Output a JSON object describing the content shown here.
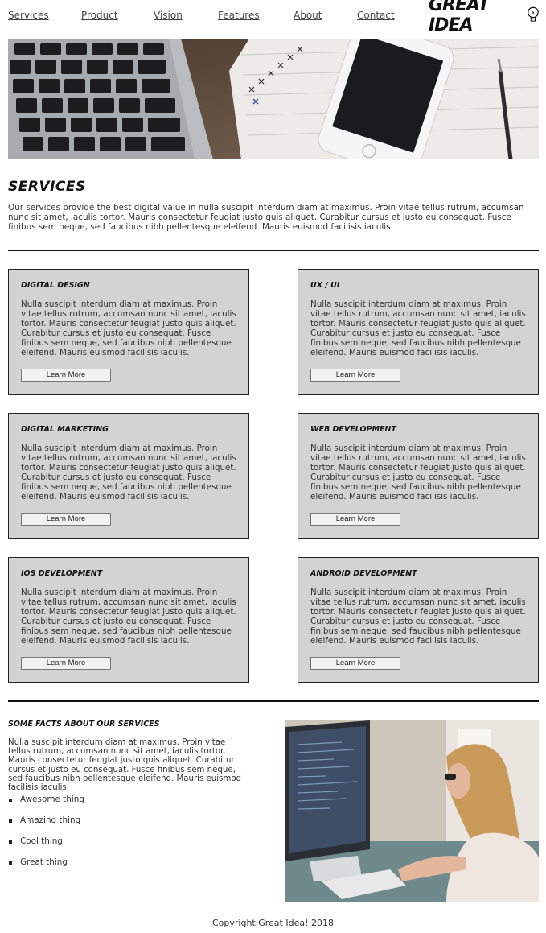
{
  "nav": {
    "items": [
      {
        "label": "Services"
      },
      {
        "label": "Product"
      },
      {
        "label": "Vision"
      },
      {
        "label": "Features"
      },
      {
        "label": "About"
      },
      {
        "label": "Contact"
      }
    ],
    "logo_text": "GREAT IDEA"
  },
  "hero": {
    "icon": "laptop-phone-notebook-photo"
  },
  "services": {
    "title": "SERVICES",
    "intro": "Our services provide the best digital value in nulla suscipit interdum diam at maximus. Proin vitae tellus rutrum, accumsan nunc sit amet, iaculis tortor. Mauris consectetur feugiat justo quis aliquet. Curabitur cursus et justo eu consequat. Fusce finibus sem neque, sed faucibus nibh pellentesque eleifend. Mauris euismod facilisis iaculis."
  },
  "cards": [
    {
      "title": "Digital Design",
      "text": "Nulla suscipit interdum diam at maximus. Proin vitae tellus rutrum, accumsan nunc sit amet, iaculis tortor. Mauris consectetur feugiat justo quis aliquet. Curabitur cursus et justo eu consequat. Fusce finibus sem neque, sed faucibus nibh pellentesque eleifend. Mauris euismod facilisis iaculis.",
      "button": "Learn More"
    },
    {
      "title": "UX / UI",
      "text": "Nulla suscipit interdum diam at maximus. Proin vitae tellus rutrum, accumsan nunc sit amet, iaculis tortor. Mauris consectetur feugiat justo quis aliquet. Curabitur cursus et justo eu consequat. Fusce finibus sem neque, sed faucibus nibh pellentesque eleifend. Mauris euismod facilisis iaculis.",
      "button": "Learn More"
    },
    {
      "title": "Digital Marketing",
      "text": "Nulla suscipit interdum diam at maximus. Proin vitae tellus rutrum, accumsan nunc sit amet, iaculis tortor. Mauris consectetur feugiat justo quis aliquet. Curabitur cursus et justo eu consequat. Fusce finibus sem neque, sed faucibus nibh pellentesque eleifend. Mauris euismod facilisis iaculis.",
      "button": "Learn More"
    },
    {
      "title": "Web Development",
      "text": "Nulla suscipit interdum diam at maximus. Proin vitae tellus rutrum, accumsan nunc sit amet, iaculis tortor. Mauris consectetur feugiat justo quis aliquet. Curabitur cursus et justo eu consequat. Fusce finibus sem neque, sed faucibus nibh pellentesque eleifend. Mauris euismod facilisis iaculis.",
      "button": "Learn More"
    },
    {
      "title": "IOS Development",
      "text": "Nulla suscipit interdum diam at maximus. Proin vitae tellus rutrum, accumsan nunc sit amet, iaculis tortor. Mauris consectetur feugiat justo quis aliquet. Curabitur cursus et justo eu consequat. Fusce finibus sem neque, sed faucibus nibh pellentesque eleifend. Mauris euismod facilisis iaculis.",
      "button": "Learn More"
    },
    {
      "title": "Android Development",
      "text": "Nulla suscipit interdum diam at maximus. Proin vitae tellus rutrum, accumsan nunc sit amet, iaculis tortor. Mauris consectetur feugiat justo quis aliquet. Curabitur cursus et justo eu consequat. Fusce finibus sem neque, sed faucibus nibh pellentesque eleifend. Mauris euismod facilisis iaculis.",
      "button": "Learn More"
    }
  ],
  "facts": {
    "title": "Some facts about our services",
    "text": "Nulla suscipit interdum diam at maximus. Proin vitae tellus rutrum, accumsan nunc sit amet, iaculis tortor. Mauris consectetur feugiat justo quis aliquet. Curabitur cursus et justo eu consequat. Fusce finibus sem neque, sed faucibus nibh pellentesque eleifend. Mauris euismod facilisis iaculis.",
    "items": [
      "Awesome thing",
      "Amazing thing",
      "Cool thing",
      "Great thing"
    ],
    "photo_icon": "woman-at-computer-photo"
  },
  "footer": {
    "copyright": "Copyright Great Idea! 2018"
  }
}
